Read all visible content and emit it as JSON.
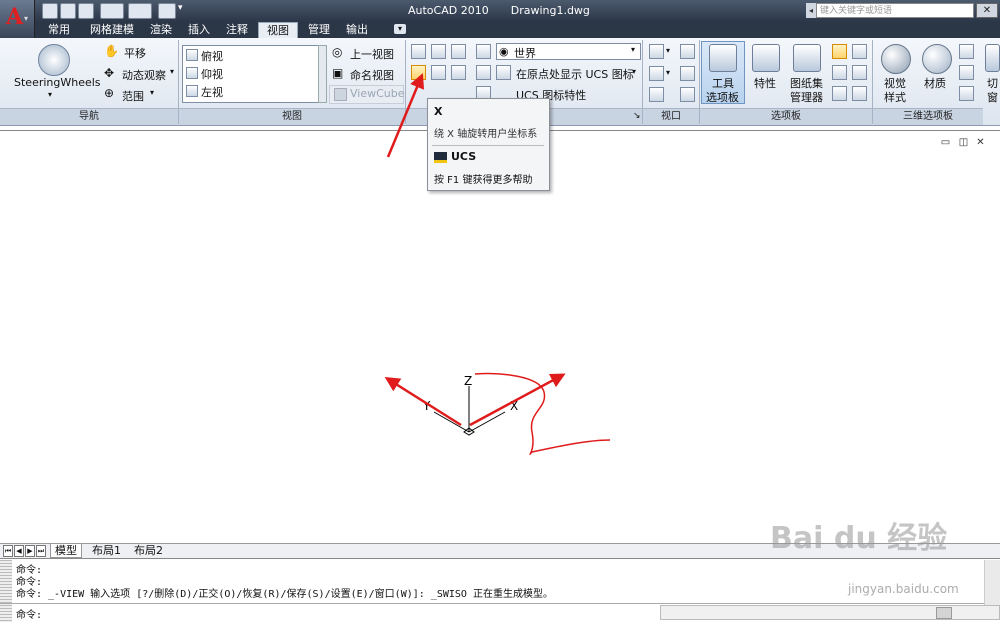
{
  "app": {
    "name": "AutoCAD 2010",
    "document": "Drawing1.dwg",
    "logo": "A"
  },
  "search": {
    "placeholder": "键入关键字或短语"
  },
  "tabs": [
    "常用",
    "网格建模",
    "渲染",
    "插入",
    "注释",
    "视图",
    "管理",
    "输出"
  ],
  "active_tab": "视图",
  "ribbon": {
    "nav": {
      "steering": "SteeringWheels",
      "pan": "平移",
      "orbit": "动态观察",
      "extents": "范围",
      "title": "导航"
    },
    "views": {
      "items": [
        "俯视",
        "仰视",
        "左视"
      ],
      "prev_view": "上一视图",
      "named_view": "命名视图",
      "viewcube": "ViewCube",
      "title": "视图"
    },
    "ucs": {
      "world": "世界",
      "show_origin": "在原点处显示 UCS 图标",
      "ucs_props": "UCS 图标特性"
    },
    "viewport": {
      "title": "视口"
    },
    "palettes": {
      "tool": "工具\n选项板",
      "tool_l1": "工具",
      "tool_l2": "选项板",
      "props": "特性",
      "sheet_l1": "图纸集",
      "sheet_l2": "管理器",
      "title": "选项板"
    },
    "visual": {
      "style_l1": "视觉",
      "style_l2": "样式",
      "material": "材质",
      "cut": "切",
      "cut2": "窗",
      "title": "三维选项板"
    }
  },
  "tooltip": {
    "title": "X",
    "desc": "绕 X 轴旋转用户坐标系",
    "command": "UCS",
    "help": "按 F1 键获得更多帮助"
  },
  "ucs_icon": {
    "z": "Z",
    "y": "Y",
    "x": "X"
  },
  "layout_tabs": [
    "模型",
    "布局1",
    "布局2"
  ],
  "command_lines": [
    "命令:",
    "命令:",
    "命令: _-VIEW 输入选项 [?/删除(D)/正交(O)/恢复(R)/保存(S)/设置(E)/窗口(W)]: _SWISO 正在重生成模型。",
    "命令:"
  ],
  "watermark": {
    "brand": "Bai du 经验",
    "url": "jingyan.baidu.com"
  },
  "colors": {
    "annotation_red": "#e01b1b",
    "titlebar": "#2b3647",
    "highlight": "#ffd36b"
  }
}
